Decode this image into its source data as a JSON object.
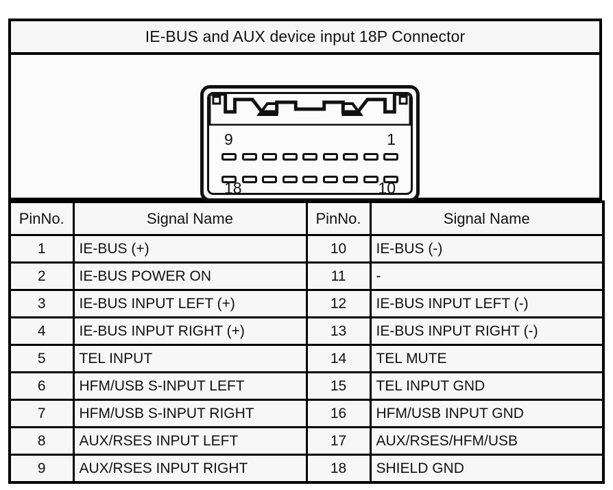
{
  "title": "IE-BUS and AUX device input 18P Connector",
  "connector": {
    "name": "18P Connector",
    "rows": 2,
    "pins_per_row": 9,
    "top_row_left_label": "9",
    "top_row_right_label": "1",
    "bottom_row_left_label": "18",
    "bottom_row_right_label": "10",
    "top_pin_count": 9,
    "bottom_pin_count": 9
  },
  "table": {
    "headers": {
      "pin": "PinNo.",
      "signal": "Signal Name",
      "pin2": "PinNo.",
      "signal2": "Signal Name"
    },
    "rows": [
      {
        "pin": "1",
        "signal": "IE-BUS (+)",
        "pin2": "10",
        "signal2": "IE-BUS (-)"
      },
      {
        "pin": "2",
        "signal": "IE-BUS POWER ON",
        "pin2": "11",
        "signal2": "-"
      },
      {
        "pin": "3",
        "signal": "IE-BUS INPUT LEFT (+)",
        "pin2": "12",
        "signal2": "IE-BUS INPUT LEFT (-)"
      },
      {
        "pin": "4",
        "signal": "IE-BUS INPUT RIGHT (+)",
        "pin2": "13",
        "signal2": "IE-BUS INPUT RIGHT (-)"
      },
      {
        "pin": "5",
        "signal": "TEL INPUT",
        "pin2": "14",
        "signal2": "TEL MUTE"
      },
      {
        "pin": "6",
        "signal": "HFM/USB S-INPUT LEFT",
        "pin2": "15",
        "signal2": "TEL INPUT GND"
      },
      {
        "pin": "7",
        "signal": "HFM/USB S-INPUT RIGHT",
        "pin2": "16",
        "signal2": "HFM/USB INPUT GND"
      },
      {
        "pin": "8",
        "signal": "AUX/RSES INPUT LEFT",
        "pin2": "17",
        "signal2": "AUX/RSES/HFM/USB"
      },
      {
        "pin": "9",
        "signal": "AUX/RSES INPUT RIGHT",
        "pin2": "18",
        "signal2": "SHIELD GND"
      }
    ]
  },
  "colors": {
    "line": "#000000",
    "text": "#111111",
    "cell_background": "#f7f7f7",
    "page_background": "#ffffff"
  }
}
